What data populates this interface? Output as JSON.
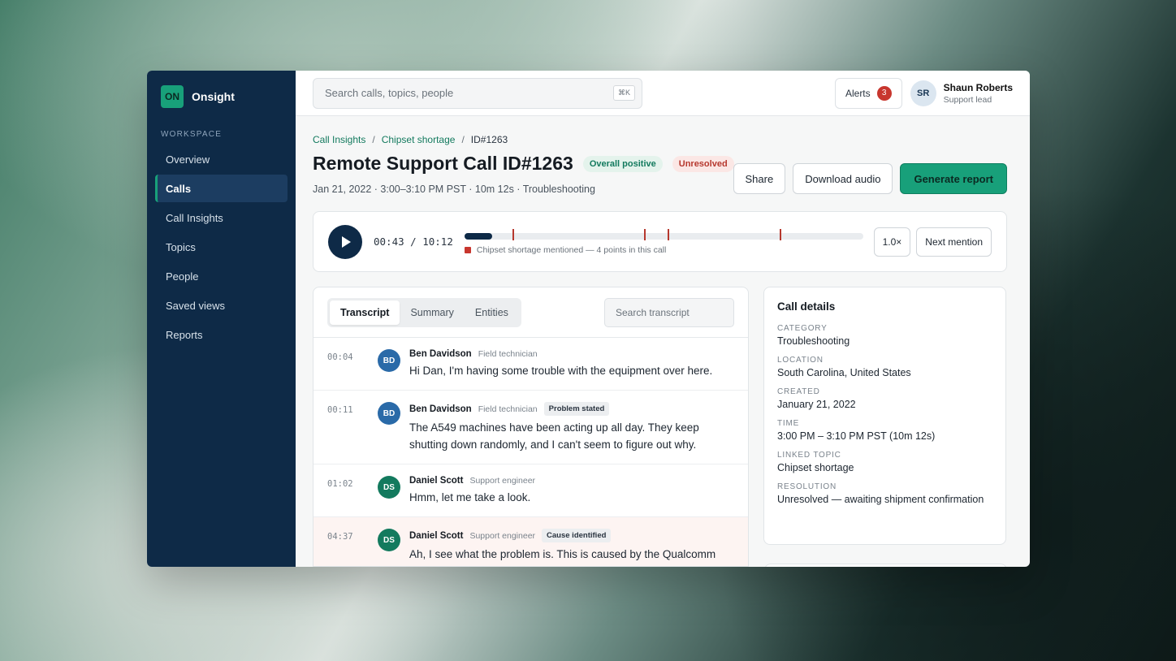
{
  "app": {
    "logo": "ON",
    "name": "Onsight"
  },
  "sidebar": {
    "section": "WORKSPACE",
    "items": [
      {
        "label": "Overview"
      },
      {
        "label": "Calls",
        "active": true
      },
      {
        "label": "Call Insights"
      },
      {
        "label": "Topics"
      },
      {
        "label": "People"
      },
      {
        "label": "Saved views"
      },
      {
        "label": "Reports"
      }
    ]
  },
  "topbar": {
    "search_placeholder": "Search calls, topics, people",
    "shortcut": "⌘K",
    "alerts_label": "Alerts",
    "alerts_count": "3",
    "user": {
      "initials": "SR",
      "name": "Shaun Roberts",
      "role": "Support lead"
    }
  },
  "breadcrumb": [
    "Call Insights",
    "Chipset shortage",
    "ID#1263"
  ],
  "call": {
    "title": "Remote Support Call ID#1263",
    "sentiment": "Overall positive",
    "status": "Unresolved",
    "meta": "Jan 21, 2022 · 3:00–3:10 PM PST · 10m 12s · Troubleshooting"
  },
  "actions": {
    "share": "Share",
    "download": "Download audio",
    "generate": "Generate report"
  },
  "player": {
    "current": "00:43",
    "total": "10:12",
    "progress": 0.07,
    "markers": [
      0.12,
      0.45,
      0.51,
      0.79
    ],
    "note": "Chipset shortage mentioned — 4 points in this call",
    "speed": "1.0×",
    "next": "Next mention"
  },
  "transcript": {
    "tabs": [
      "Transcript",
      "Summary",
      "Entities"
    ],
    "search_placeholder": "Search transcript",
    "entries": [
      {
        "time": "00:04",
        "initials": "BD",
        "name": "Ben Davidson",
        "role": "Field technician",
        "tag": "",
        "text": "Hi Dan, I'm having some trouble with the equipment over here."
      },
      {
        "time": "00:11",
        "initials": "BD",
        "name": "Ben Davidson",
        "role": "Field technician",
        "tag": "Problem stated",
        "text": "The A549 machines have been acting up all day. They keep shutting down randomly, and I can't seem to figure out why."
      },
      {
        "time": "01:02",
        "initials": "DS",
        "name": "Daniel Scott",
        "role": "Support engineer",
        "tag": "",
        "text": "Hmm, let me take a look."
      },
      {
        "time": "04:37",
        "initials": "DS",
        "name": "Daniel Scott",
        "role": "Support engineer",
        "tag": "Cause identified",
        "text": "Ah, I see what the problem is. This is caused by the Qualcomm"
      }
    ]
  },
  "details": {
    "title": "Call details",
    "fields": [
      {
        "label": "CATEGORY",
        "value": "Troubleshooting"
      },
      {
        "label": "LOCATION",
        "value": "South Carolina, United States"
      },
      {
        "label": "CREATED",
        "value": "January 21, 2022"
      },
      {
        "label": "TIME",
        "value": "3:00 PM – 3:10 PM PST (10m 12s)"
      },
      {
        "label": "LINKED TOPIC",
        "value": "Chipset shortage"
      },
      {
        "label": "RESOLUTION",
        "value": "Unresolved — awaiting shipment confirmation"
      }
    ]
  },
  "colors": {
    "sidebar": "#0e2a47",
    "accent": "#18a07a",
    "alert": "#c8362e"
  }
}
